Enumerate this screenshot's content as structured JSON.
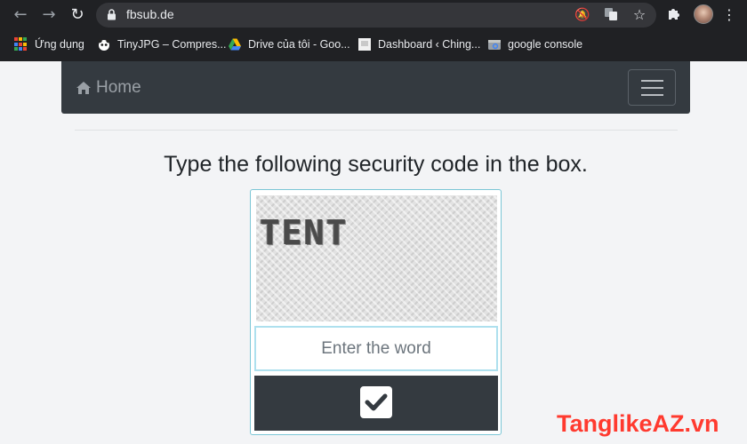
{
  "browser": {
    "url": "fbsub.de",
    "bookmarks": [
      {
        "label": "Ứng dụng",
        "icon": "apps-grid-icon"
      },
      {
        "label": "TinyJPG – Compres...",
        "icon": "panda-icon"
      },
      {
        "label": "Drive của tôi - Goo...",
        "icon": "google-drive-icon"
      },
      {
        "label": "Dashboard ‹ Ching...",
        "icon": "dashboard-icon"
      },
      {
        "label": "google console",
        "icon": "search-console-icon"
      }
    ]
  },
  "navbar": {
    "home_label": "Home",
    "home_icon": "home-icon",
    "toggler_icon": "hamburger-icon",
    "background": "#343a40"
  },
  "main": {
    "heading": "Type the following security code in the box.",
    "captcha": {
      "word": "TENT",
      "input_placeholder": "Enter the word",
      "input_value": "",
      "submit_icon": "checkmark-icon"
    }
  },
  "watermark": "TanglikeAZ.vn",
  "colors": {
    "chrome_bg": "#202124",
    "page_bg": "#f3f4f6",
    "box_border": "#7bc6d6",
    "watermark": "#ff3a2f"
  }
}
